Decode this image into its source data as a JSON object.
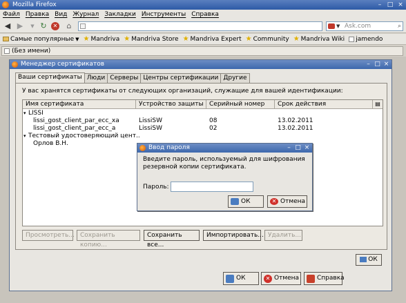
{
  "window": {
    "title": "Mozilla Firefox"
  },
  "menu": [
    "Файл",
    "Правка",
    "Вид",
    "Журнал",
    "Закладки",
    "Инструменты",
    "Справка"
  ],
  "search": {
    "placeholder": "Ask.com"
  },
  "bookmarks": [
    {
      "label": "Самые популярные",
      "kind": "folder"
    },
    {
      "label": "Mandriva",
      "kind": "star"
    },
    {
      "label": "Mandriva Store",
      "kind": "star"
    },
    {
      "label": "Mandriva Expert",
      "kind": "star"
    },
    {
      "label": "Community",
      "kind": "star"
    },
    {
      "label": "Mandriva Wiki",
      "kind": "star"
    },
    {
      "label": "jamendo",
      "kind": "page"
    }
  ],
  "browser_tab": {
    "label": "(Без имени)"
  },
  "cert_manager": {
    "title": "Менеджер сертификатов",
    "tabs": [
      "Ваши сертификаты",
      "Люди",
      "Серверы",
      "Центры сертификации",
      "Другие"
    ],
    "description": "У вас хранятся сертификаты от следующих организаций, служащие для вашей идентификации:",
    "columns": [
      "Имя сертификата",
      "Устройство защиты",
      "Серийный номер",
      "Срок действия"
    ],
    "rows": [
      {
        "name": "LISSI",
        "device": "",
        "serial": "",
        "expires": "",
        "group": true
      },
      {
        "name": "lissi_gost_client_par_ecc_xa",
        "device": "LissiSW",
        "serial": "08",
        "expires": "13.02.2011",
        "group": false
      },
      {
        "name": "lissi_gost_client_par_ecc_a",
        "device": "LissiSW",
        "serial": "02",
        "expires": "13.02.2011",
        "group": false
      },
      {
        "name": "Тестовый удостоверяющий цент...",
        "device": "",
        "serial": "",
        "expires": "",
        "group": true
      },
      {
        "name": "Орлов В.Н.",
        "device": "",
        "serial": "",
        "expires": "",
        "group": false
      }
    ],
    "buttons": {
      "view": "Просмотреть...",
      "backup": "Сохранить копию...",
      "backup_all": "Сохранить все...",
      "import": "Импортировать...",
      "delete": "Удалить..."
    },
    "ok": "ОК",
    "footer": {
      "ok": "ОК",
      "cancel": "Отмена",
      "help": "Справка"
    }
  },
  "password_dialog": {
    "title": "Ввод пароля",
    "message": "Введите пароль, используемый для шифрования резервной копии сертификата.",
    "label": "Пароль:",
    "value": "",
    "ok": "ОК",
    "cancel": "Отмена"
  }
}
